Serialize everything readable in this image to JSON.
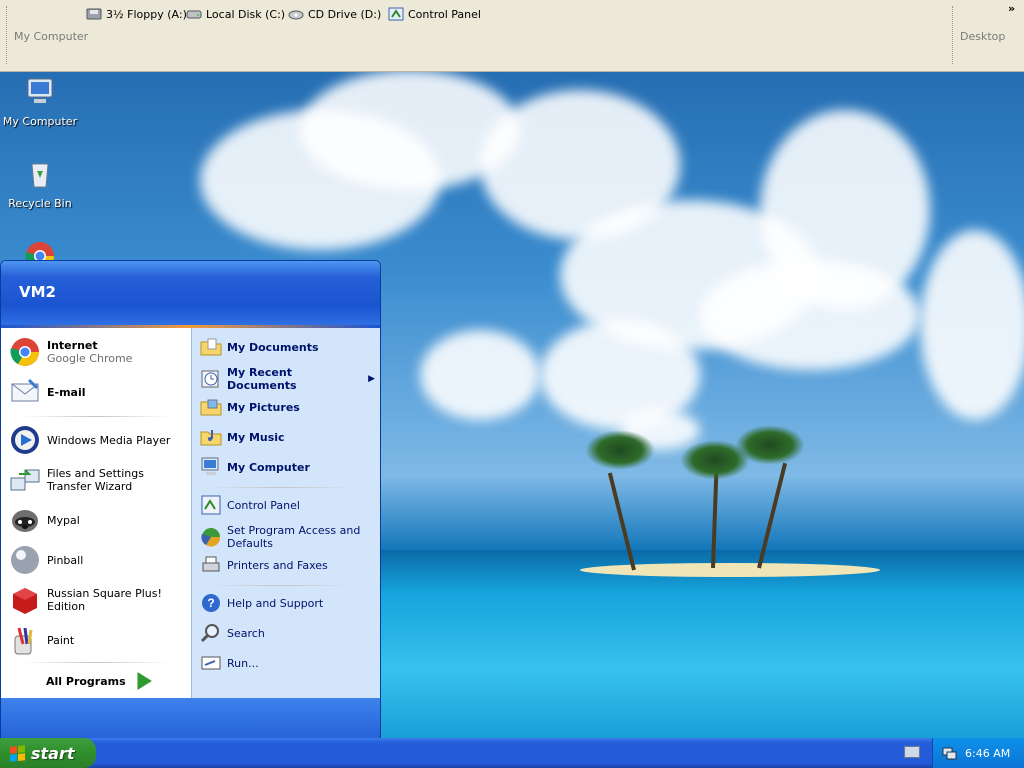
{
  "toolbar": {
    "left_label": "My Computer",
    "right_label": "Desktop",
    "chevron": "»",
    "items": [
      {
        "label": "3½ Floppy (A:)",
        "icon": "floppy-icon"
      },
      {
        "label": "Local Disk (C:)",
        "icon": "disk-icon"
      },
      {
        "label": "CD Drive (D:)",
        "icon": "cd-icon"
      },
      {
        "label": "Control Panel",
        "icon": "control-panel-icon"
      }
    ]
  },
  "desktop": {
    "icons": [
      {
        "label": "My Computer",
        "icon": "my-computer-icon"
      },
      {
        "label": "Recycle Bin",
        "icon": "recycle-bin-icon"
      },
      {
        "label": "",
        "icon": "chrome-icon"
      }
    ]
  },
  "start_menu": {
    "user": "VM2",
    "pinned": [
      {
        "title": "Internet",
        "subtitle": "Google Chrome",
        "icon": "chrome-icon"
      },
      {
        "title": "E-mail",
        "subtitle": "",
        "icon": "email-icon"
      }
    ],
    "recent": [
      {
        "label": "Windows Media Player",
        "icon": "media-player-icon"
      },
      {
        "label": "Files and Settings Transfer Wizard",
        "icon": "transfer-wizard-icon"
      },
      {
        "label": "Mypal",
        "icon": "mypal-icon"
      },
      {
        "label": "Pinball",
        "icon": "pinball-icon"
      },
      {
        "label": "Russian Square Plus! Edition",
        "icon": "russian-square-icon"
      },
      {
        "label": "Paint",
        "icon": "paint-icon"
      }
    ],
    "all_programs": "All Programs",
    "right_items": [
      {
        "label": "My Documents",
        "icon": "folder-documents-icon",
        "bold": true
      },
      {
        "label": "My Recent Documents",
        "icon": "recent-documents-icon",
        "bold": true,
        "submenu": true
      },
      {
        "label": "My Pictures",
        "icon": "folder-pictures-icon",
        "bold": true
      },
      {
        "label": "My Music",
        "icon": "folder-music-icon",
        "bold": true
      },
      {
        "label": "My Computer",
        "icon": "my-computer-icon",
        "bold": true
      },
      {
        "label": "Control Panel",
        "icon": "control-panel-icon",
        "bold": false
      },
      {
        "label": "Set Program Access and Defaults",
        "icon": "program-defaults-icon",
        "bold": false
      },
      {
        "label": "Printers and Faxes",
        "icon": "printer-icon",
        "bold": false
      },
      {
        "label": "Help and Support",
        "icon": "help-icon",
        "bold": false
      },
      {
        "label": "Search",
        "icon": "search-icon",
        "bold": false
      },
      {
        "label": "Run...",
        "icon": "run-icon",
        "bold": false
      }
    ]
  },
  "taskbar": {
    "start_label": "start",
    "clock": "6:46 AM"
  }
}
